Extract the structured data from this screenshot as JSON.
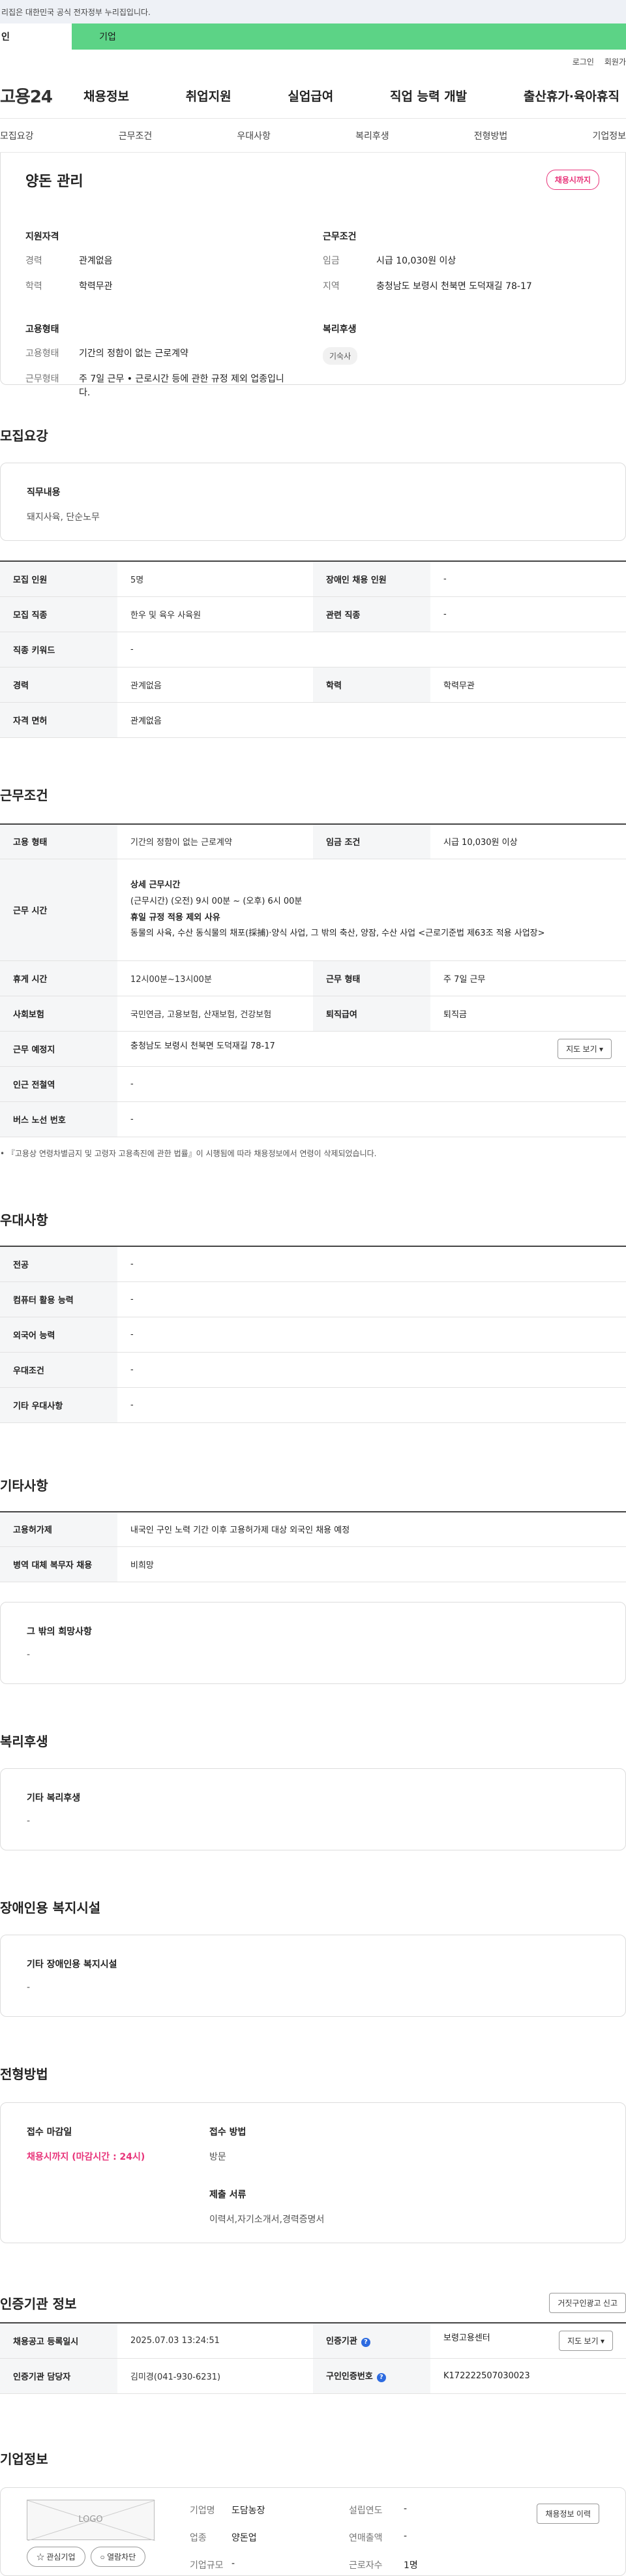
{
  "gov_notice": "리집은 대한민국 공식 전자정부 누리집입니다.",
  "user_tabs": [
    "인",
    "기업"
  ],
  "util": {
    "login": "로그인",
    "signup": "회원가"
  },
  "logo": "고용24",
  "gnb": [
    "채용정보",
    "취업지원",
    "실업급여",
    "직업 능력 개발",
    "출산휴가·육아휴직"
  ],
  "subnav": [
    "모집요강",
    "근무조건",
    "우대사항",
    "복리후생",
    "전형방법",
    "기업정보"
  ],
  "job": {
    "title": "양돈 관리",
    "badge": "채용시까지",
    "qual_head": "지원자격",
    "qual": [
      {
        "k": "경력",
        "v": "관계없음"
      },
      {
        "k": "학력",
        "v": "학력무관"
      }
    ],
    "cond_head": "근무조건",
    "cond": [
      {
        "k": "임금",
        "v": "시급 10,030원 이상"
      },
      {
        "k": "지역",
        "v": "충청남도 보령시 천북면 도덕재길 78-17"
      }
    ],
    "emp_head": "고용형태",
    "emp": [
      {
        "k": "고용형태",
        "v": "기간의 정함이 없는 근로계약"
      },
      {
        "k": "근무형태",
        "v": "주 7일 근무 • 근로시간 등에 관한 규정 제외 업종입니다."
      }
    ],
    "welfare_head": "복리후생",
    "welfare_chip": "기숙사"
  },
  "recruit": {
    "title": "모집요강",
    "duty_head": "직무내용",
    "duty_val": "돼지사육, 단순노무",
    "rows": [
      {
        "k1": "모집 인원",
        "v1": "5명",
        "k2": "장애인 채용 인원",
        "v2": "-"
      },
      {
        "k1": "모집 직종",
        "v1": "한우 및 육우 사육원",
        "k2": "관련 직종",
        "v2": "-"
      },
      {
        "k1": "직종 키워드",
        "v1": "-"
      },
      {
        "k1": "경력",
        "v1": "관계없음",
        "k2": "학력",
        "v2": "학력무관"
      },
      {
        "k1": "자격 면허",
        "v1": "관계없음"
      }
    ]
  },
  "work": {
    "title": "근무조건",
    "r_emp": {
      "k1": "고용 형태",
      "v1": "기간의 정함이 없는 근로계약",
      "k2": "임금 조건",
      "v2": "시급 10,030원 이상"
    },
    "r_time": {
      "k": "근무 시간",
      "h1": "상세 근무시간",
      "l1": "(근무시간) (오전) 9시 00분 ~ (오후) 6시 00분",
      "h2": "휴일 규정 적용 제외 사유",
      "l2": "동물의 사육, 수산 동식물의 채포(採捕)·양식 사업, 그 밖의 축산, 양잠, 수산 사업 <근로기준법 제63조 적용 사업장>"
    },
    "r_rest": {
      "k1": "휴게 시간",
      "v1": "12시00분~13시00분",
      "k2": "근무 형태",
      "v2": "주 7일 근무"
    },
    "r_ins": {
      "k1": "사회보험",
      "v1": "국민연금, 고용보험, 산재보험, 건강보험",
      "k2": "퇴직급여",
      "v2": "퇴직금"
    },
    "r_loc": {
      "k": "근무 예정지",
      "v": "충청남도 보령시 천북면 도덕재길 78-17",
      "btn": "지도 보기 ▾"
    },
    "r_sub": {
      "k": "인근 전철역",
      "v": "-"
    },
    "r_bus": {
      "k": "버스 노선 번호",
      "v": "-"
    },
    "note": "• 『고용상 연령차별금지 및 고령자 고용촉진에 관한 법률』이 시행됨에 따라 채용정보에서 연령이 삭제되었습니다."
  },
  "prefer": {
    "title": "우대사항",
    "rows": [
      {
        "k": "전공",
        "v": "-"
      },
      {
        "k": "컴퓨터 활용 능력",
        "v": "-"
      },
      {
        "k": "외국어 능력",
        "v": "-"
      },
      {
        "k": "우대조건",
        "v": "-"
      },
      {
        "k": "기타 우대사항",
        "v": "-"
      }
    ]
  },
  "other": {
    "title": "기타사항",
    "rows": [
      {
        "k": "고용허가제",
        "v": "내국인 구인 노력 기간 이후 고용허가제 대상 외국인 채용 예정"
      },
      {
        "k": "병역 대체 복무자 채용",
        "v": "비희망"
      }
    ],
    "box_head": "그 밖의 희망사항",
    "box_val": "-"
  },
  "benefit": {
    "title": "복리후생",
    "box_head": "기타 복리후생",
    "box_val": "-"
  },
  "disabled": {
    "title": "장애인용 복지시설",
    "box_head": "기타 장애인용 복지시설",
    "box_val": "-"
  },
  "process": {
    "title": "전형방법",
    "deadline_head": "접수 마감일",
    "deadline_val": "채용시까지 (마감시간 : 24시)",
    "method_head": "접수 방법",
    "method_val": "방문",
    "docs_head": "제출 서류",
    "docs_val": "이력서,자기소개서,경력증명서"
  },
  "agency": {
    "title": "인증기관 정보",
    "btn_report": "거짓구인광고 신고",
    "r1": {
      "k1": "채용공고 등록일시",
      "v1": "2025.07.03 13:24:51",
      "k2": "인증기관",
      "v2": "보령고용센터",
      "btn": "지도 보기 ▾"
    },
    "r2": {
      "k1": "인증기관 담당자",
      "v1": "김미경(041-930-6231)",
      "k2": "구인인증번호",
      "v2": "K172222507030023"
    }
  },
  "company": {
    "title": "기업정보",
    "logo_text": "LOGO",
    "btn_fav": "☆ 관심기업",
    "btn_blank": "○ 열람차단",
    "btn_history": "채용정보 이력",
    "fields": [
      {
        "k": "기업명",
        "v": "도담농장"
      },
      {
        "k": "설립연도",
        "v": "-"
      },
      {
        "k": "업종",
        "v": "양돈업"
      },
      {
        "k": "연매출액",
        "v": "-"
      },
      {
        "k": "기업규모",
        "v": "-"
      },
      {
        "k": "근로자수",
        "v": "1명"
      }
    ]
  }
}
